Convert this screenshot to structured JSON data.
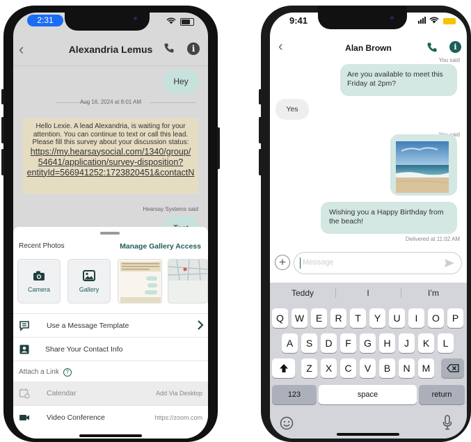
{
  "left_phone": {
    "status": {
      "time": "2:31"
    },
    "header": {
      "back": "‹",
      "title": "Alexandria Lemus"
    },
    "messages": {
      "hey": "Hey",
      "date": "Aug 16, 2024 at 8:01 AM",
      "system_text": "Hello Lexie. A lead Alexandria, is waiting for your attention. You can continue to text or call this lead. Please fill this survey about your discussion status:",
      "link_lines": [
        "https://my.hearsaysocial.com/1340/group/",
        "54641/application/survey-disposition?",
        "entityId=566941252:1723820451&contactN"
      ],
      "sender": "Hearsay Systems said",
      "test": "Test"
    },
    "sheet": {
      "recent_photos": "Recent Photos",
      "manage_gallery": "Manage Gallery Access",
      "tiles": [
        {
          "label": "Camera",
          "icon": "camera-icon"
        },
        {
          "label": "Gallery",
          "icon": "gallery-icon"
        }
      ],
      "message_template": "Use a Message Template",
      "share_contact": "Share Your Contact Info",
      "attach_link": "Attach a Link",
      "calendar": {
        "label": "Calendar",
        "right": "Add Via Desktop"
      },
      "video": {
        "label": "Video Conference",
        "right": "https://zoom.com"
      }
    }
  },
  "right_phone": {
    "status": {
      "time": "9:41"
    },
    "header": {
      "back": "‹",
      "title": "Alan Brown"
    },
    "messages": {
      "you_said_1": "You said",
      "meet": "Are you available to meet this Friday at 2pm?",
      "yes": "Yes",
      "you_said_2": "You said",
      "birthday": "Wishing you a Happy Birthday from the beach!",
      "delivered": "Delivered at 11:02 AM"
    },
    "input": {
      "placeholder": "Message"
    },
    "keyboard": {
      "suggestions": [
        "Teddy",
        "I",
        "I’m"
      ],
      "row1": [
        "Q",
        "W",
        "E",
        "R",
        "T",
        "Y",
        "U",
        "I",
        "O",
        "P"
      ],
      "row2": [
        "A",
        "S",
        "D",
        "F",
        "G",
        "H",
        "J",
        "K",
        "L"
      ],
      "row3": [
        "Z",
        "X",
        "C",
        "V",
        "B",
        "N",
        "M"
      ],
      "numbers": "123",
      "space": "space",
      "return": "return"
    }
  },
  "colors": {
    "accent": "#1f5f59",
    "bubble_out": "#c7e2dc",
    "system_bg": "#e6dcc2",
    "status_pill": "#1b6cf5"
  }
}
